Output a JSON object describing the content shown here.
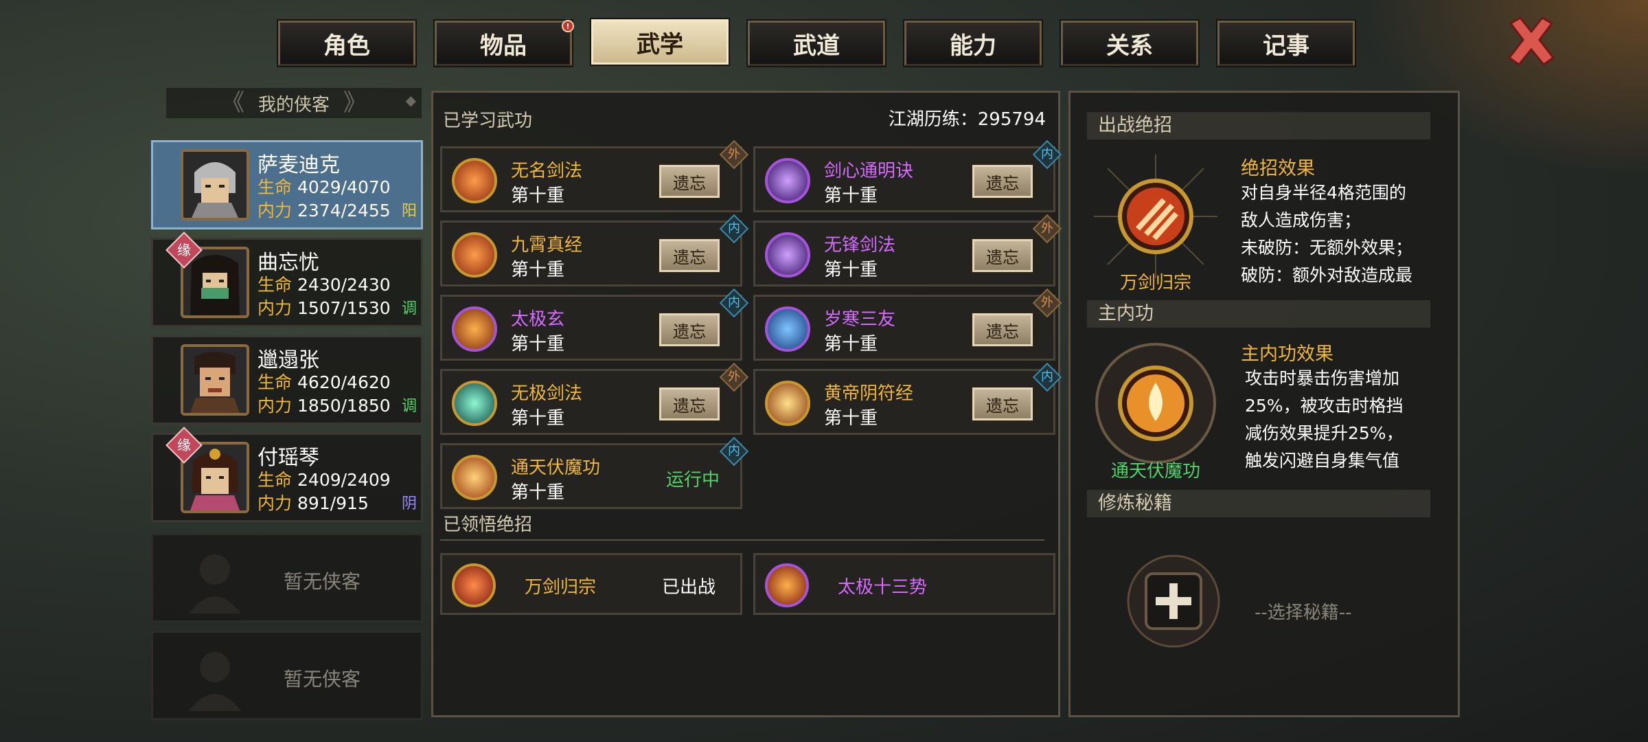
{
  "tabs": [
    {
      "label": "角色",
      "active": false,
      "alert": false
    },
    {
      "label": "物品",
      "active": false,
      "alert": true
    },
    {
      "label": "武学",
      "active": true,
      "alert": false
    },
    {
      "label": "武道",
      "active": false,
      "alert": false
    },
    {
      "label": "能力",
      "active": false,
      "alert": false
    },
    {
      "label": "关系",
      "active": false,
      "alert": false
    },
    {
      "label": "记事",
      "active": false,
      "alert": false
    }
  ],
  "tab_alert_mark": "!",
  "close_icon": "close-x-icon",
  "roster": {
    "title": "我的侠客",
    "characters": [
      {
        "name": "萨麦迪克",
        "hp_label": "生命",
        "hp": "4029/4070",
        "mp_label": "内力",
        "mp": "2374/2455",
        "type": "阳",
        "type_color": "#f0d030",
        "bond": "",
        "selected": true
      },
      {
        "name": "曲忘忧",
        "hp_label": "生命",
        "hp": "2430/2430",
        "mp_label": "内力",
        "mp": "1507/1530",
        "type": "调",
        "type_color": "#52d36a",
        "bond": "缘",
        "selected": false
      },
      {
        "name": "邋遢张",
        "hp_label": "生命",
        "hp": "4620/4620",
        "mp_label": "内力",
        "mp": "1850/1850",
        "type": "调",
        "type_color": "#52d36a",
        "bond": "",
        "selected": false
      },
      {
        "name": "付瑶琴",
        "hp_label": "生命",
        "hp": "2409/2409",
        "mp_label": "内力",
        "mp": "891/915",
        "type": "阴",
        "type_color": "#9b8cff",
        "bond": "缘",
        "selected": false
      }
    ],
    "empty_label": "暂无侠客"
  },
  "martial": {
    "learned_title": "已学习武功",
    "experience": "江湖历练：295794",
    "forget_label": "遗忘",
    "skills": [
      {
        "name": "无名剑法",
        "level": "第十重",
        "tag": "外",
        "name_color": "gold",
        "icon": "sword-slash-icon"
      },
      {
        "name": "剑心通明诀",
        "level": "第十重",
        "tag": "内",
        "name_color": "violet",
        "icon": "sword-mind-icon"
      },
      {
        "name": "九霄真经",
        "level": "第十重",
        "tag": "内",
        "name_color": "gold",
        "icon": "cloud-palm-icon"
      },
      {
        "name": "无锋剑法",
        "level": "第十重",
        "tag": "外",
        "name_color": "violet",
        "icon": "edgeless-sword-icon"
      },
      {
        "name": "太极玄",
        "level": "第十重",
        "tag": "内",
        "name_color": "violet",
        "icon": "taiji-fire-icon"
      },
      {
        "name": "岁寒三友",
        "level": "第十重",
        "tag": "外",
        "name_color": "violet",
        "icon": "frost-blade-icon"
      },
      {
        "name": "无极剑法",
        "level": "第十重",
        "tag": "外",
        "name_color": "gold",
        "icon": "wuji-sword-icon"
      },
      {
        "name": "黄帝阴符经",
        "level": "第十重",
        "tag": "内",
        "name_color": "gold",
        "icon": "yellow-emperor-icon"
      },
      {
        "name": "通天伏魔功",
        "level": "第十重",
        "tag": "内",
        "name_color": "gold",
        "icon": "demon-subduing-icon",
        "status": "运行中"
      }
    ],
    "ult_title": "已领悟绝招",
    "ults": [
      {
        "name": "万剑归宗",
        "status": "已出战",
        "name_color": "gold",
        "icon": "ten-thousand-swords-icon"
      },
      {
        "name": "太极十三势",
        "status": "",
        "name_color": "violet",
        "icon": "taiji-thirteen-icon"
      }
    ]
  },
  "detail": {
    "battle_ult_title": "出战绝招",
    "battle_ult_name": "万剑归宗",
    "battle_ult_effect_title": "绝招效果",
    "battle_ult_effect": [
      "对自身半径4格范围的",
      "敌人造成伤害；",
      "未破防：无额外效果；",
      "破防：额外对敌造成最"
    ],
    "main_inner_title": "主内功",
    "main_inner_name": "通天伏魔功",
    "main_inner_effect_title": "主内功效果",
    "main_inner_effect": [
      "攻击时暴击伤害增加",
      "25%，被攻击时格挡",
      "减伤效果提升25%，",
      "触发闪避自身集气值"
    ],
    "book_title": "修炼秘籍",
    "book_placeholder": "--选择秘籍--"
  }
}
